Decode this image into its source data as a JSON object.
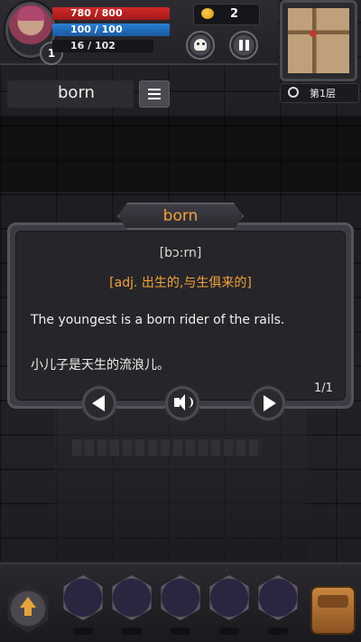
{
  "hud": {
    "hp": "780 / 800",
    "mp": "100 / 100",
    "xp": "16 / 102",
    "level": "1",
    "coins": "2",
    "floor": "第1层"
  },
  "word": {
    "text": "born",
    "phonetic": "[bɔ:rn]",
    "pos": "adj.",
    "definition": "出生的,与生俱来的",
    "example_en": "The youngest is a born rider of the rails.",
    "example_cn": "小儿子是天生的流浪儿。",
    "pager": "1/1"
  },
  "colors": {
    "accent": "#f3a338",
    "hp": "#c62828",
    "mp": "#1e6fc0"
  },
  "icons": [
    "skull-icon",
    "pause-icon",
    "list-icon",
    "prev-arrow-icon",
    "speaker-icon",
    "next-arrow-icon",
    "up-arrow-icon",
    "backpack-icon",
    "search-icon",
    "coin-icon"
  ]
}
